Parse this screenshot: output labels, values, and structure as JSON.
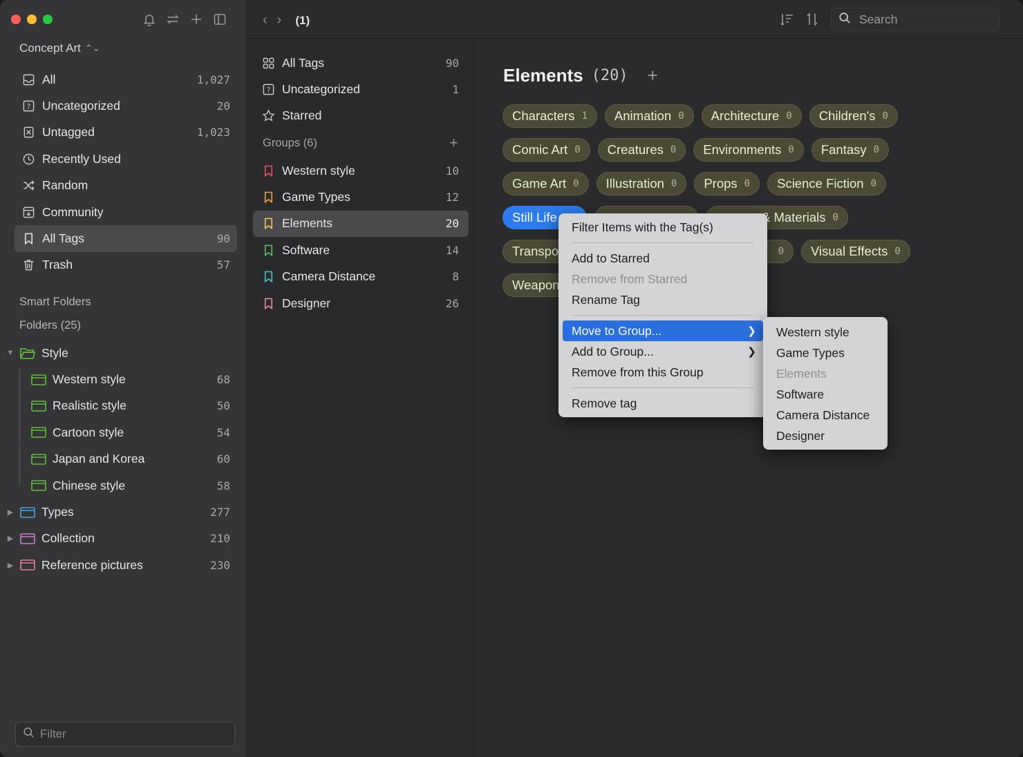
{
  "sidebar": {
    "library": "Concept Art",
    "items": [
      {
        "label": "All",
        "count": "1,027",
        "icon": "tray-icon"
      },
      {
        "label": "Uncategorized",
        "count": "20",
        "icon": "question-box-icon"
      },
      {
        "label": "Untagged",
        "count": "1,023",
        "icon": "tag-off-icon"
      },
      {
        "label": "Recently Used",
        "count": "",
        "icon": "clock-icon"
      },
      {
        "label": "Random",
        "count": "",
        "icon": "shuffle-icon"
      },
      {
        "label": "Community",
        "count": "",
        "icon": "community-icon"
      },
      {
        "label": "All Tags",
        "count": "90",
        "icon": "bookmark-icon"
      },
      {
        "label": "Trash",
        "count": "57",
        "icon": "trash-icon"
      }
    ],
    "smart_folders": "Smart Folders",
    "folders_header": "Folders (25)",
    "folders": [
      {
        "label": "Style",
        "count": "",
        "level": 0,
        "expanded": true,
        "color": "#5fc13a"
      },
      {
        "label": "Western style",
        "count": "68",
        "level": 1,
        "color": "#5fc13a"
      },
      {
        "label": "Realistic style",
        "count": "50",
        "level": 1,
        "color": "#5fc13a"
      },
      {
        "label": "Cartoon style",
        "count": "54",
        "level": 1,
        "color": "#5fc13a"
      },
      {
        "label": "Japan and Korea",
        "count": "60",
        "level": 1,
        "color": "#5fc13a"
      },
      {
        "label": "Chinese style",
        "count": "58",
        "level": 1,
        "color": "#5fc13a"
      },
      {
        "label": "Types",
        "count": "277",
        "level": 0,
        "color": "#3fa6e8"
      },
      {
        "label": "Collection",
        "count": "210",
        "level": 0,
        "color": "#d67bd0"
      },
      {
        "label": "Reference pictures",
        "count": "230",
        "level": 0,
        "color": "#e57fa5"
      }
    ],
    "filter_placeholder": "Filter"
  },
  "toolbar": {
    "page": "(1)",
    "search_placeholder": "Search"
  },
  "groups_panel": {
    "top": [
      {
        "label": "All Tags",
        "count": "90",
        "icon": "grid-icon"
      },
      {
        "label": "Uncategorized",
        "count": "1",
        "icon": "question-box-icon"
      },
      {
        "label": "Starred",
        "count": "",
        "icon": "star-icon"
      }
    ],
    "groups_header": "Groups (6)",
    "groups": [
      {
        "label": "Western style",
        "count": "10",
        "color": "#e0555a"
      },
      {
        "label": "Game Types",
        "count": "12",
        "color": "#f0a23a"
      },
      {
        "label": "Elements",
        "count": "20",
        "color": "#f0c84a"
      },
      {
        "label": "Software",
        "count": "14",
        "color": "#4ec45a"
      },
      {
        "label": "Camera Distance",
        "count": "8",
        "color": "#3cc7c0"
      },
      {
        "label": "Designer",
        "count": "26",
        "color": "#e58aa8"
      }
    ]
  },
  "main": {
    "title": "Elements",
    "count": "(20)",
    "tags": [
      [
        {
          "label": "Characters",
          "count": "1"
        },
        {
          "label": "Animation",
          "count": "0"
        },
        {
          "label": "Architecture",
          "count": "0"
        },
        {
          "label": "Children's",
          "count": "0"
        }
      ],
      [
        {
          "label": "Comic Art",
          "count": "0"
        },
        {
          "label": "Creatures",
          "count": "0"
        },
        {
          "label": "Environments",
          "count": "0"
        },
        {
          "label": "Fantasy",
          "count": "0"
        }
      ],
      [
        {
          "label": "Game Art",
          "count": "0"
        },
        {
          "label": "Illustration",
          "count": "0"
        },
        {
          "label": "Props",
          "count": "0"
        },
        {
          "label": "Science Fiction",
          "count": "0"
        }
      ],
      [
        {
          "label": "Still Life",
          "count": ""
        },
        {
          "label": "",
          "count": ""
        },
        {
          "label": "& Materials",
          "count": "0"
        }
      ],
      [
        {
          "label": "Transpo",
          "count": ""
        },
        {
          "label": "",
          "count": "0"
        },
        {
          "label": "Visual Effects",
          "count": "0"
        }
      ],
      [
        {
          "label": "Weapon",
          "count": ""
        }
      ]
    ]
  },
  "context_menu": {
    "items": [
      {
        "label": "Filter Items with the Tag(s)"
      },
      {
        "label": "Add to Starred"
      },
      {
        "label": "Remove from Starred",
        "disabled": true
      },
      {
        "label": "Rename Tag"
      },
      {
        "label": "Move to Group...",
        "highlighted": true
      },
      {
        "label": "Add to Group..."
      },
      {
        "label": "Remove from this Group"
      },
      {
        "label": "Remove tag"
      }
    ]
  },
  "submenu": {
    "items": [
      {
        "label": "Western style"
      },
      {
        "label": "Game Types"
      },
      {
        "label": "Elements",
        "disabled": true
      },
      {
        "label": "Software"
      },
      {
        "label": "Camera Distance"
      },
      {
        "label": "Designer"
      }
    ]
  }
}
